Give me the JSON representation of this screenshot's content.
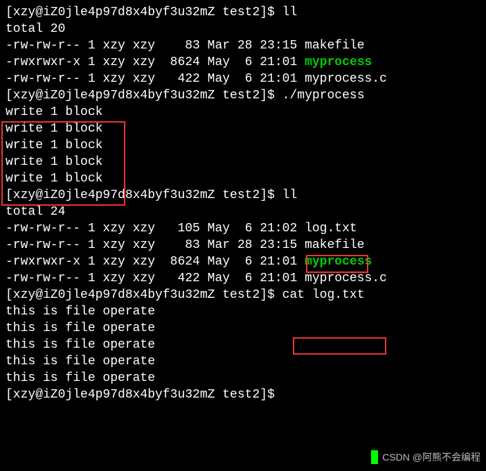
{
  "prompt_user": "xzy",
  "prompt_host": "iZ0jle4p97d8x4byf3u32mZ",
  "prompt_dir": "test2",
  "prompt_suffix": "$",
  "cmd1": "ll",
  "ll1": {
    "total": "total 20",
    "rows": [
      {
        "perm": "-rw-rw-r--",
        "links": "1",
        "owner": "xzy",
        "group": "xzy",
        "size": "   83",
        "date": "Mar 28 23:15",
        "name": "makefile",
        "exec": false
      },
      {
        "perm": "-rwxrwxr-x",
        "links": "1",
        "owner": "xzy",
        "group": "xzy",
        "size": " 8624",
        "date": "May  6 21:01",
        "name": "myprocess",
        "exec": true
      },
      {
        "perm": "-rw-rw-r--",
        "links": "1",
        "owner": "xzy",
        "group": "xzy",
        "size": "  422",
        "date": "May  6 21:01",
        "name": "myprocess.c",
        "exec": false
      }
    ]
  },
  "cmd2": "./myprocess",
  "run_output": [
    "write 1 block",
    "write 1 block",
    "write 1 block",
    "write 1 block",
    "write 1 block"
  ],
  "cmd3": "ll",
  "ll2": {
    "total": "total 24",
    "rows": [
      {
        "perm": "-rw-rw-r--",
        "links": "1",
        "owner": "xzy",
        "group": "xzy",
        "size": "  105",
        "date": "May  6 21:02",
        "name": "log.txt",
        "exec": false
      },
      {
        "perm": "-rw-rw-r--",
        "links": "1",
        "owner": "xzy",
        "group": "xzy",
        "size": "   83",
        "date": "Mar 28 23:15",
        "name": "makefile",
        "exec": false
      },
      {
        "perm": "-rwxrwxr-x",
        "links": "1",
        "owner": "xzy",
        "group": "xzy",
        "size": " 8624",
        "date": "May  6 21:01",
        "name": "myprocess",
        "exec": true
      },
      {
        "perm": "-rw-rw-r--",
        "links": "1",
        "owner": "xzy",
        "group": "xzy",
        "size": "  422",
        "date": "May  6 21:01",
        "name": "myprocess.c",
        "exec": false
      }
    ]
  },
  "cmd4": "cat log.txt",
  "cat_output": [
    "this is file operate",
    "this is file operate",
    "this is file operate",
    "this is file operate",
    "this is file operate"
  ],
  "watermark": "CSDN @阿熊不会编程"
}
